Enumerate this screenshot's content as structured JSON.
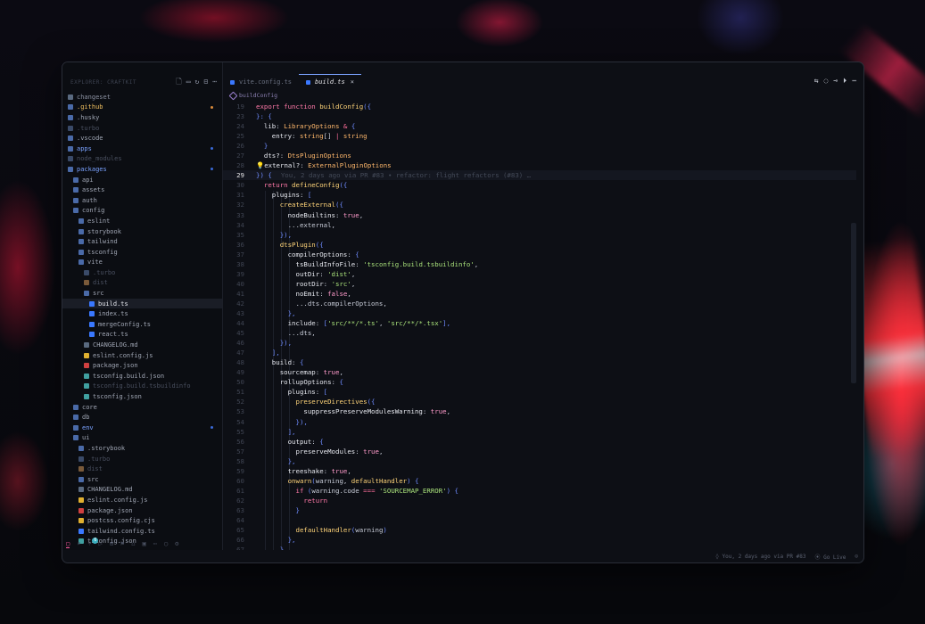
{
  "window": {
    "traffic_colors": [
      "#ff5f57",
      "#febc2e",
      "#28c840"
    ]
  },
  "sidebar": {
    "title": "EXPLORER: CRAFTKIT",
    "actions": [
      "new-file-icon",
      "new-folder-icon",
      "refresh-icon",
      "collapse-icon",
      "more-icon"
    ],
    "items": [
      {
        "label": "changeset",
        "level": 0,
        "kind": "folder",
        "color": "#8a90a0",
        "icon_color": "#5a6a80"
      },
      {
        "label": ".github",
        "level": 0,
        "kind": "folder",
        "color": "#f0c060",
        "icon_color": "#4a6aa8",
        "dot": "#d98a3a"
      },
      {
        "label": ".husky",
        "level": 0,
        "kind": "folder",
        "color": "#a0a6b4",
        "icon_color": "#4a6aa8"
      },
      {
        "label": ".turbo",
        "level": 0,
        "kind": "folder",
        "color": "#4a5060",
        "icon_color": "#3a4a68"
      },
      {
        "label": ".vscode",
        "level": 0,
        "kind": "folder",
        "color": "#a0a6b4",
        "icon_color": "#4a6aa8"
      },
      {
        "label": "apps",
        "level": 0,
        "kind": "folder",
        "color": "#7aa2ff",
        "icon_color": "#4a6aa8",
        "dot": "#3a6ad8"
      },
      {
        "label": "node_modules",
        "level": 0,
        "kind": "folder",
        "color": "#4a5060",
        "icon_color": "#3a4a68"
      },
      {
        "label": "packages",
        "level": 0,
        "kind": "folder",
        "color": "#7aa2ff",
        "icon_color": "#4a6aa8",
        "dot": "#3a6ad8"
      },
      {
        "label": "api",
        "level": 1,
        "kind": "folder",
        "color": "#a0a6b4",
        "icon_color": "#4a6aa8"
      },
      {
        "label": "assets",
        "level": 1,
        "kind": "folder",
        "color": "#a0a6b4",
        "icon_color": "#4a6aa8"
      },
      {
        "label": "auth",
        "level": 1,
        "kind": "folder",
        "color": "#a0a6b4",
        "icon_color": "#4a6aa8"
      },
      {
        "label": "config",
        "level": 1,
        "kind": "folder",
        "color": "#a0a6b4",
        "icon_color": "#4a6aa8"
      },
      {
        "label": "eslint",
        "level": 2,
        "kind": "folder",
        "color": "#a0a6b4",
        "icon_color": "#4a6aa8"
      },
      {
        "label": "storybook",
        "level": 2,
        "kind": "folder",
        "color": "#a0a6b4",
        "icon_color": "#4a6aa8"
      },
      {
        "label": "tailwind",
        "level": 2,
        "kind": "folder",
        "color": "#a0a6b4",
        "icon_color": "#4a6aa8"
      },
      {
        "label": "tsconfig",
        "level": 2,
        "kind": "folder",
        "color": "#a0a6b4",
        "icon_color": "#4a6aa8"
      },
      {
        "label": "vite",
        "level": 2,
        "kind": "folder",
        "color": "#a0a6b4",
        "icon_color": "#4a6aa8"
      },
      {
        "label": ".turbo",
        "level": 3,
        "kind": "folder",
        "color": "#4a5060",
        "icon_color": "#3a4a68"
      },
      {
        "label": "dist",
        "level": 3,
        "kind": "folder",
        "color": "#4a5060",
        "icon_color": "#7a5a3a"
      },
      {
        "label": "src",
        "level": 3,
        "kind": "folder",
        "color": "#a0a6b4",
        "icon_color": "#4a6aa8"
      },
      {
        "label": "build.ts",
        "level": 4,
        "kind": "ts",
        "color": "#e6e8ef",
        "icon_color": "#3a78ff",
        "selected": true
      },
      {
        "label": "index.ts",
        "level": 4,
        "kind": "ts",
        "color": "#a0a6b4",
        "icon_color": "#3a78ff"
      },
      {
        "label": "mergeConfig.ts",
        "level": 4,
        "kind": "ts",
        "color": "#a0a6b4",
        "icon_color": "#3a78ff"
      },
      {
        "label": "react.ts",
        "level": 4,
        "kind": "ts",
        "color": "#a0a6b4",
        "icon_color": "#3a78ff"
      },
      {
        "label": "CHANGELOG.md",
        "level": 3,
        "kind": "md",
        "color": "#a0a6b4",
        "icon_color": "#5a6a80"
      },
      {
        "label": "eslint.config.js",
        "level": 3,
        "kind": "js",
        "color": "#a0a6b4",
        "icon_color": "#e0b030"
      },
      {
        "label": "package.json",
        "level": 3,
        "kind": "pkg",
        "color": "#a0a6b4",
        "icon_color": "#d04040"
      },
      {
        "label": "tsconfig.build.json",
        "level": 3,
        "kind": "json",
        "color": "#a0a6b4",
        "icon_color": "#40a0a0"
      },
      {
        "label": "tsconfig.build.tsbuildinfo",
        "level": 3,
        "kind": "json",
        "color": "#4a5060",
        "icon_color": "#40a0a0"
      },
      {
        "label": "tsconfig.json",
        "level": 3,
        "kind": "json",
        "color": "#a0a6b4",
        "icon_color": "#40a0a0"
      },
      {
        "label": "core",
        "level": 1,
        "kind": "folder",
        "color": "#a0a6b4",
        "icon_color": "#4a6aa8"
      },
      {
        "label": "db",
        "level": 1,
        "kind": "folder",
        "color": "#a0a6b4",
        "icon_color": "#4a6aa8"
      },
      {
        "label": "env",
        "level": 1,
        "kind": "folder",
        "color": "#7aa2ff",
        "icon_color": "#4a6aa8",
        "dot": "#3a6ad8"
      },
      {
        "label": "ui",
        "level": 1,
        "kind": "folder",
        "color": "#a0a6b4",
        "icon_color": "#4a6aa8"
      },
      {
        "label": ".storybook",
        "level": 2,
        "kind": "folder",
        "color": "#a0a6b4",
        "icon_color": "#4a6aa8"
      },
      {
        "label": ".turbo",
        "level": 2,
        "kind": "folder",
        "color": "#4a5060",
        "icon_color": "#3a4a68"
      },
      {
        "label": "dist",
        "level": 2,
        "kind": "folder",
        "color": "#4a5060",
        "icon_color": "#7a5a3a"
      },
      {
        "label": "src",
        "level": 2,
        "kind": "folder",
        "color": "#a0a6b4",
        "icon_color": "#4a6aa8"
      },
      {
        "label": "CHANGELOG.md",
        "level": 2,
        "kind": "md",
        "color": "#a0a6b4",
        "icon_color": "#5a6a80"
      },
      {
        "label": "eslint.config.js",
        "level": 2,
        "kind": "js",
        "color": "#a0a6b4",
        "icon_color": "#e0b030"
      },
      {
        "label": "package.json",
        "level": 2,
        "kind": "pkg",
        "color": "#a0a6b4",
        "icon_color": "#d04040"
      },
      {
        "label": "postcss.config.cjs",
        "level": 2,
        "kind": "js",
        "color": "#a0a6b4",
        "icon_color": "#e0b030"
      },
      {
        "label": "tailwind.config.ts",
        "level": 2,
        "kind": "ts",
        "color": "#a0a6b4",
        "icon_color": "#3a78ff"
      },
      {
        "label": "tsconfig.json",
        "level": 2,
        "kind": "json",
        "color": "#a0a6b4",
        "icon_color": "#40a0a0"
      }
    ],
    "status_icons": [
      "files-icon",
      "search-icon",
      "source-control-icon",
      "run-icon",
      "extensions-icon",
      "debug-icon",
      "remote-icon",
      "docker-icon",
      "more-icon",
      "account-icon",
      "settings-icon"
    ],
    "scm_badge": "6"
  },
  "tabs": [
    {
      "label": "vite.config.ts",
      "active": false
    },
    {
      "label": "build.ts",
      "active": true,
      "close": "×"
    }
  ],
  "editor_actions": [
    "compare-icon",
    "go-back-icon",
    "go-forward-icon",
    "run-icon",
    "more-icon"
  ],
  "breadcrumb": "buildConfig",
  "code": {
    "blame": "You, 2 days ago via PR #83 • refactor: flight refactors (#83) …",
    "current_line": 29,
    "lines": [
      {
        "n": "19",
        "t": [
          [
            "export ",
            "kw"
          ],
          [
            "function ",
            "kw"
          ],
          [
            "buildConfig",
            "f"
          ],
          [
            "({",
            "pun"
          ]
        ]
      },
      {
        "n": "23",
        "t": [
          [
            "}: ",
            "pun"
          ],
          [
            "{",
            "pun"
          ]
        ]
      },
      {
        "n": "24",
        "t": [
          [
            "  lib",
            "pr"
          ],
          [
            ": ",
            "ct"
          ],
          [
            "LibraryOptions ",
            "ty"
          ],
          [
            "& ",
            "op"
          ],
          [
            "{",
            "pun"
          ]
        ]
      },
      {
        "n": "25",
        "t": [
          [
            "    entry",
            "pr"
          ],
          [
            ": ",
            "ct"
          ],
          [
            "string",
            "ty"
          ],
          [
            "[] ",
            "ct"
          ],
          [
            "| ",
            "op"
          ],
          [
            "string",
            "ty"
          ]
        ]
      },
      {
        "n": "26",
        "t": [
          [
            "  }",
            "pun"
          ]
        ]
      },
      {
        "n": "27",
        "t": [
          [
            "  dts?",
            "pr"
          ],
          [
            ": ",
            "ct"
          ],
          [
            "DtsPluginOptions",
            "ty"
          ]
        ]
      },
      {
        "n": "28",
        "t": [
          [
            "💡",
            "ty"
          ],
          [
            "external?",
            "pr"
          ],
          [
            ": ",
            "ct"
          ],
          [
            "ExternalPluginOptions",
            "ty"
          ]
        ]
      },
      {
        "n": "29",
        "t": [
          [
            "}) ",
            "pun"
          ],
          [
            "{",
            "pun"
          ]
        ],
        "blame": true
      },
      {
        "n": "30",
        "t": [
          [
            "  return ",
            "kw"
          ],
          [
            "defineConfig",
            "f"
          ],
          [
            "({",
            "pun"
          ]
        ]
      },
      {
        "n": "31",
        "t": [
          [
            "    plugins",
            "pr"
          ],
          [
            ": ",
            "ct"
          ],
          [
            "[",
            "pun"
          ]
        ]
      },
      {
        "n": "32",
        "t": [
          [
            "      createExternal",
            "f"
          ],
          [
            "({",
            "pun"
          ]
        ]
      },
      {
        "n": "33",
        "t": [
          [
            "        nodeBuiltins",
            "pr"
          ],
          [
            ": ",
            "ct"
          ],
          [
            "true",
            "bool"
          ],
          [
            ",",
            "ct"
          ]
        ]
      },
      {
        "n": "34",
        "t": [
          [
            "        ...external",
            "ct"
          ],
          [
            ",",
            "ct"
          ]
        ]
      },
      {
        "n": "35",
        "t": [
          [
            "      }),",
            "pun"
          ]
        ]
      },
      {
        "n": "36",
        "t": [
          [
            "      dtsPlugin",
            "f"
          ],
          [
            "({",
            "pun"
          ]
        ]
      },
      {
        "n": "37",
        "t": [
          [
            "        compilerOptions",
            "pr"
          ],
          [
            ": ",
            "ct"
          ],
          [
            "{",
            "pun"
          ]
        ]
      },
      {
        "n": "38",
        "t": [
          [
            "          tsBuildInfoFile",
            "pr"
          ],
          [
            ": ",
            "ct"
          ],
          [
            "'tsconfig.build.tsbuildinfo'",
            "str"
          ],
          [
            ",",
            "ct"
          ]
        ]
      },
      {
        "n": "39",
        "t": [
          [
            "          outDir",
            "pr"
          ],
          [
            ": ",
            "ct"
          ],
          [
            "'dist'",
            "str"
          ],
          [
            ",",
            "ct"
          ]
        ]
      },
      {
        "n": "40",
        "t": [
          [
            "          rootDir",
            "pr"
          ],
          [
            ": ",
            "ct"
          ],
          [
            "'src'",
            "str"
          ],
          [
            ",",
            "ct"
          ]
        ]
      },
      {
        "n": "41",
        "t": [
          [
            "          noEmit",
            "pr"
          ],
          [
            ": ",
            "ct"
          ],
          [
            "false",
            "bool"
          ],
          [
            ",",
            "ct"
          ]
        ]
      },
      {
        "n": "42",
        "t": [
          [
            "          ...dts.compilerOptions",
            "ct"
          ],
          [
            ",",
            "ct"
          ]
        ]
      },
      {
        "n": "43",
        "t": [
          [
            "        },",
            "pun"
          ]
        ]
      },
      {
        "n": "44",
        "t": [
          [
            "        include",
            "pr"
          ],
          [
            ": ",
            "ct"
          ],
          [
            "[",
            "pun"
          ],
          [
            "'src/**/*.ts'",
            "str"
          ],
          [
            ", ",
            "ct"
          ],
          [
            "'src/**/*.tsx'",
            "str"
          ],
          [
            "],",
            "pun"
          ]
        ]
      },
      {
        "n": "45",
        "t": [
          [
            "        ...dts",
            "ct"
          ],
          [
            ",",
            "ct"
          ]
        ]
      },
      {
        "n": "46",
        "t": [
          [
            "      }),",
            "pun"
          ]
        ]
      },
      {
        "n": "47",
        "t": [
          [
            "    ],",
            "pun"
          ]
        ]
      },
      {
        "n": "48",
        "t": [
          [
            "    build",
            "pr"
          ],
          [
            ": ",
            "ct"
          ],
          [
            "{",
            "pun"
          ]
        ]
      },
      {
        "n": "49",
        "t": [
          [
            "      sourcemap",
            "pr"
          ],
          [
            ": ",
            "ct"
          ],
          [
            "true",
            "bool"
          ],
          [
            ",",
            "ct"
          ]
        ]
      },
      {
        "n": "50",
        "t": [
          [
            "      rollupOptions",
            "pr"
          ],
          [
            ": ",
            "ct"
          ],
          [
            "{",
            "pun"
          ]
        ]
      },
      {
        "n": "51",
        "t": [
          [
            "        plugins",
            "pr"
          ],
          [
            ": ",
            "ct"
          ],
          [
            "[",
            "pun"
          ]
        ]
      },
      {
        "n": "52",
        "t": [
          [
            "          preserveDirectives",
            "f"
          ],
          [
            "({",
            "pun"
          ]
        ]
      },
      {
        "n": "53",
        "t": [
          [
            "            suppressPreserveModulesWarning",
            "pr"
          ],
          [
            ": ",
            "ct"
          ],
          [
            "true",
            "bool"
          ],
          [
            ",",
            "ct"
          ]
        ]
      },
      {
        "n": "54",
        "t": [
          [
            "          }),",
            "pun"
          ]
        ]
      },
      {
        "n": "55",
        "t": [
          [
            "        ],",
            "pun"
          ]
        ]
      },
      {
        "n": "56",
        "t": [
          [
            "        output",
            "pr"
          ],
          [
            ": ",
            "ct"
          ],
          [
            "{",
            "pun"
          ]
        ]
      },
      {
        "n": "57",
        "t": [
          [
            "          preserveModules",
            "pr"
          ],
          [
            ": ",
            "ct"
          ],
          [
            "true",
            "bool"
          ],
          [
            ",",
            "ct"
          ]
        ]
      },
      {
        "n": "58",
        "t": [
          [
            "        },",
            "pun"
          ]
        ]
      },
      {
        "n": "59",
        "t": [
          [
            "        treeshake",
            "pr"
          ],
          [
            ": ",
            "ct"
          ],
          [
            "true",
            "bool"
          ],
          [
            ",",
            "ct"
          ]
        ]
      },
      {
        "n": "60",
        "t": [
          [
            "        onwarn",
            "f"
          ],
          [
            "(",
            "pun"
          ],
          [
            "warning, ",
            "ct"
          ],
          [
            "defaultHandler",
            "f"
          ],
          [
            ") ",
            "pun"
          ],
          [
            "{",
            "pun"
          ]
        ]
      },
      {
        "n": "61",
        "t": [
          [
            "          if ",
            "kw"
          ],
          [
            "(",
            "pun"
          ],
          [
            "warning.code ",
            "ct"
          ],
          [
            "=== ",
            "op"
          ],
          [
            "'SOURCEMAP_ERROR'",
            "str"
          ],
          [
            ") ",
            "pun"
          ],
          [
            "{",
            "pun"
          ]
        ]
      },
      {
        "n": "62",
        "t": [
          [
            "            return",
            "kw"
          ]
        ]
      },
      {
        "n": "63",
        "t": [
          [
            "          }",
            "pun"
          ]
        ]
      },
      {
        "n": "64",
        "t": [
          [
            "",
            "ct"
          ]
        ]
      },
      {
        "n": "65",
        "t": [
          [
            "          defaultHandler",
            "f"
          ],
          [
            "(",
            "pun"
          ],
          [
            "warning",
            "ct"
          ],
          [
            ")",
            "pun"
          ]
        ]
      },
      {
        "n": "66",
        "t": [
          [
            "        },",
            "pun"
          ]
        ]
      },
      {
        "n": "67",
        "t": [
          [
            "      }",
            "pun"
          ]
        ]
      }
    ]
  },
  "status_bar": {
    "blame": "You, 2 days ago via PR #83",
    "go_live": "Go Live"
  }
}
